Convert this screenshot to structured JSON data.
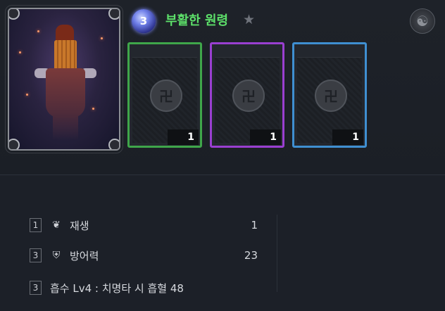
{
  "header": {
    "level": "3",
    "title": "부활한 원령",
    "star_icon": "star-icon",
    "corner_icon": "gear-icon"
  },
  "cards": [
    {
      "count": "1",
      "border_color": "#3fa64a"
    },
    {
      "count": "1",
      "border_color": "#9a3fd1"
    },
    {
      "count": "1",
      "border_color": "#3f8fd1"
    }
  ],
  "stats": [
    {
      "num": "1",
      "icon": "sprout-icon",
      "label": "재생",
      "value": "1"
    },
    {
      "num": "3",
      "icon": "shield-icon",
      "label": "방어력",
      "value": "23"
    },
    {
      "num": "3",
      "icon": "",
      "label": "흡수 Lv4 : 치명타 시 흡혈 48",
      "value": ""
    }
  ],
  "colors": {
    "title": "#5de06a",
    "background": "#1c2028"
  }
}
